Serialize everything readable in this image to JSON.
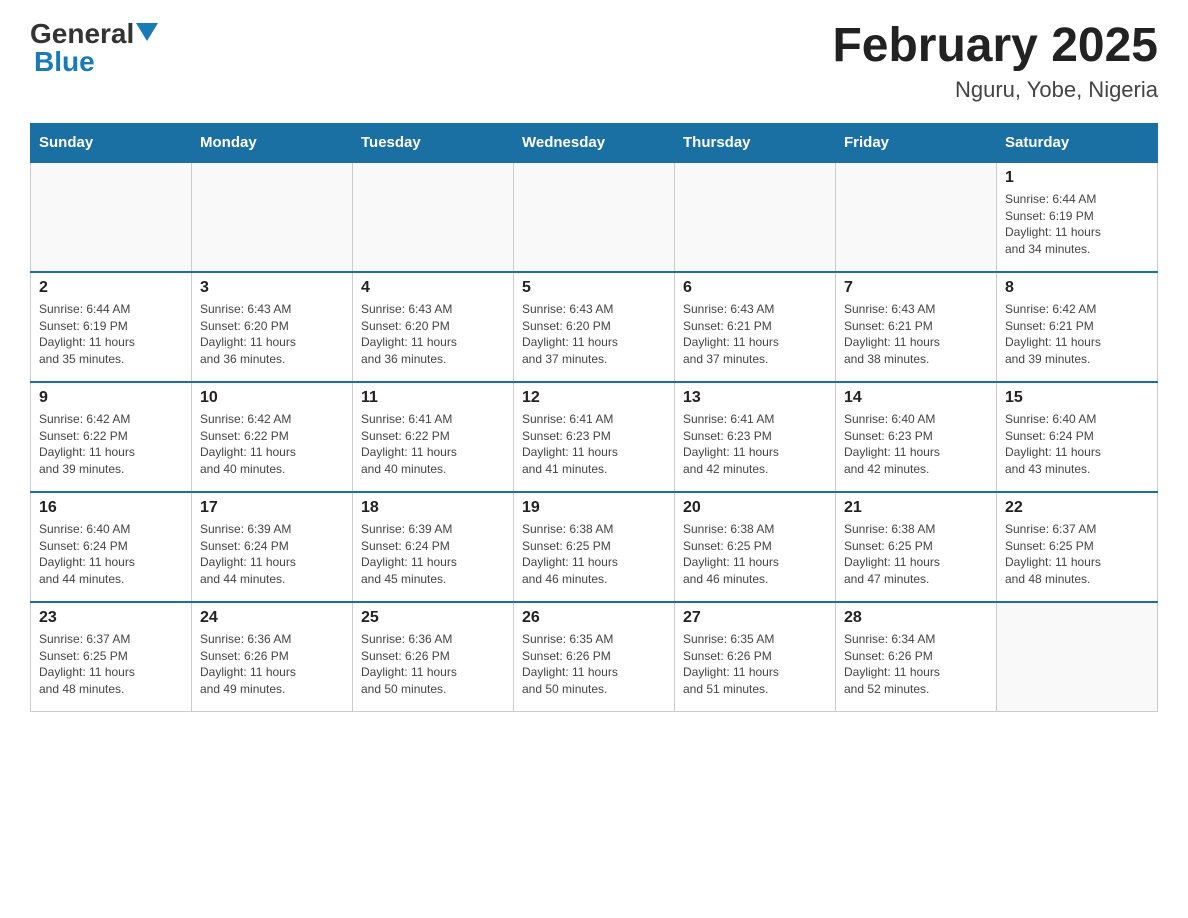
{
  "header": {
    "logo_general": "General",
    "logo_blue": "Blue",
    "title": "February 2025",
    "subtitle": "Nguru, Yobe, Nigeria"
  },
  "days_of_week": [
    "Sunday",
    "Monday",
    "Tuesday",
    "Wednesday",
    "Thursday",
    "Friday",
    "Saturday"
  ],
  "weeks": [
    [
      {
        "day": "",
        "info": ""
      },
      {
        "day": "",
        "info": ""
      },
      {
        "day": "",
        "info": ""
      },
      {
        "day": "",
        "info": ""
      },
      {
        "day": "",
        "info": ""
      },
      {
        "day": "",
        "info": ""
      },
      {
        "day": "1",
        "info": "Sunrise: 6:44 AM\nSunset: 6:19 PM\nDaylight: 11 hours\nand 34 minutes."
      }
    ],
    [
      {
        "day": "2",
        "info": "Sunrise: 6:44 AM\nSunset: 6:19 PM\nDaylight: 11 hours\nand 35 minutes."
      },
      {
        "day": "3",
        "info": "Sunrise: 6:43 AM\nSunset: 6:20 PM\nDaylight: 11 hours\nand 36 minutes."
      },
      {
        "day": "4",
        "info": "Sunrise: 6:43 AM\nSunset: 6:20 PM\nDaylight: 11 hours\nand 36 minutes."
      },
      {
        "day": "5",
        "info": "Sunrise: 6:43 AM\nSunset: 6:20 PM\nDaylight: 11 hours\nand 37 minutes."
      },
      {
        "day": "6",
        "info": "Sunrise: 6:43 AM\nSunset: 6:21 PM\nDaylight: 11 hours\nand 37 minutes."
      },
      {
        "day": "7",
        "info": "Sunrise: 6:43 AM\nSunset: 6:21 PM\nDaylight: 11 hours\nand 38 minutes."
      },
      {
        "day": "8",
        "info": "Sunrise: 6:42 AM\nSunset: 6:21 PM\nDaylight: 11 hours\nand 39 minutes."
      }
    ],
    [
      {
        "day": "9",
        "info": "Sunrise: 6:42 AM\nSunset: 6:22 PM\nDaylight: 11 hours\nand 39 minutes."
      },
      {
        "day": "10",
        "info": "Sunrise: 6:42 AM\nSunset: 6:22 PM\nDaylight: 11 hours\nand 40 minutes."
      },
      {
        "day": "11",
        "info": "Sunrise: 6:41 AM\nSunset: 6:22 PM\nDaylight: 11 hours\nand 40 minutes."
      },
      {
        "day": "12",
        "info": "Sunrise: 6:41 AM\nSunset: 6:23 PM\nDaylight: 11 hours\nand 41 minutes."
      },
      {
        "day": "13",
        "info": "Sunrise: 6:41 AM\nSunset: 6:23 PM\nDaylight: 11 hours\nand 42 minutes."
      },
      {
        "day": "14",
        "info": "Sunrise: 6:40 AM\nSunset: 6:23 PM\nDaylight: 11 hours\nand 42 minutes."
      },
      {
        "day": "15",
        "info": "Sunrise: 6:40 AM\nSunset: 6:24 PM\nDaylight: 11 hours\nand 43 minutes."
      }
    ],
    [
      {
        "day": "16",
        "info": "Sunrise: 6:40 AM\nSunset: 6:24 PM\nDaylight: 11 hours\nand 44 minutes."
      },
      {
        "day": "17",
        "info": "Sunrise: 6:39 AM\nSunset: 6:24 PM\nDaylight: 11 hours\nand 44 minutes."
      },
      {
        "day": "18",
        "info": "Sunrise: 6:39 AM\nSunset: 6:24 PM\nDaylight: 11 hours\nand 45 minutes."
      },
      {
        "day": "19",
        "info": "Sunrise: 6:38 AM\nSunset: 6:25 PM\nDaylight: 11 hours\nand 46 minutes."
      },
      {
        "day": "20",
        "info": "Sunrise: 6:38 AM\nSunset: 6:25 PM\nDaylight: 11 hours\nand 46 minutes."
      },
      {
        "day": "21",
        "info": "Sunrise: 6:38 AM\nSunset: 6:25 PM\nDaylight: 11 hours\nand 47 minutes."
      },
      {
        "day": "22",
        "info": "Sunrise: 6:37 AM\nSunset: 6:25 PM\nDaylight: 11 hours\nand 48 minutes."
      }
    ],
    [
      {
        "day": "23",
        "info": "Sunrise: 6:37 AM\nSunset: 6:25 PM\nDaylight: 11 hours\nand 48 minutes."
      },
      {
        "day": "24",
        "info": "Sunrise: 6:36 AM\nSunset: 6:26 PM\nDaylight: 11 hours\nand 49 minutes."
      },
      {
        "day": "25",
        "info": "Sunrise: 6:36 AM\nSunset: 6:26 PM\nDaylight: 11 hours\nand 50 minutes."
      },
      {
        "day": "26",
        "info": "Sunrise: 6:35 AM\nSunset: 6:26 PM\nDaylight: 11 hours\nand 50 minutes."
      },
      {
        "day": "27",
        "info": "Sunrise: 6:35 AM\nSunset: 6:26 PM\nDaylight: 11 hours\nand 51 minutes."
      },
      {
        "day": "28",
        "info": "Sunrise: 6:34 AM\nSunset: 6:26 PM\nDaylight: 11 hours\nand 52 minutes."
      },
      {
        "day": "",
        "info": ""
      }
    ]
  ]
}
